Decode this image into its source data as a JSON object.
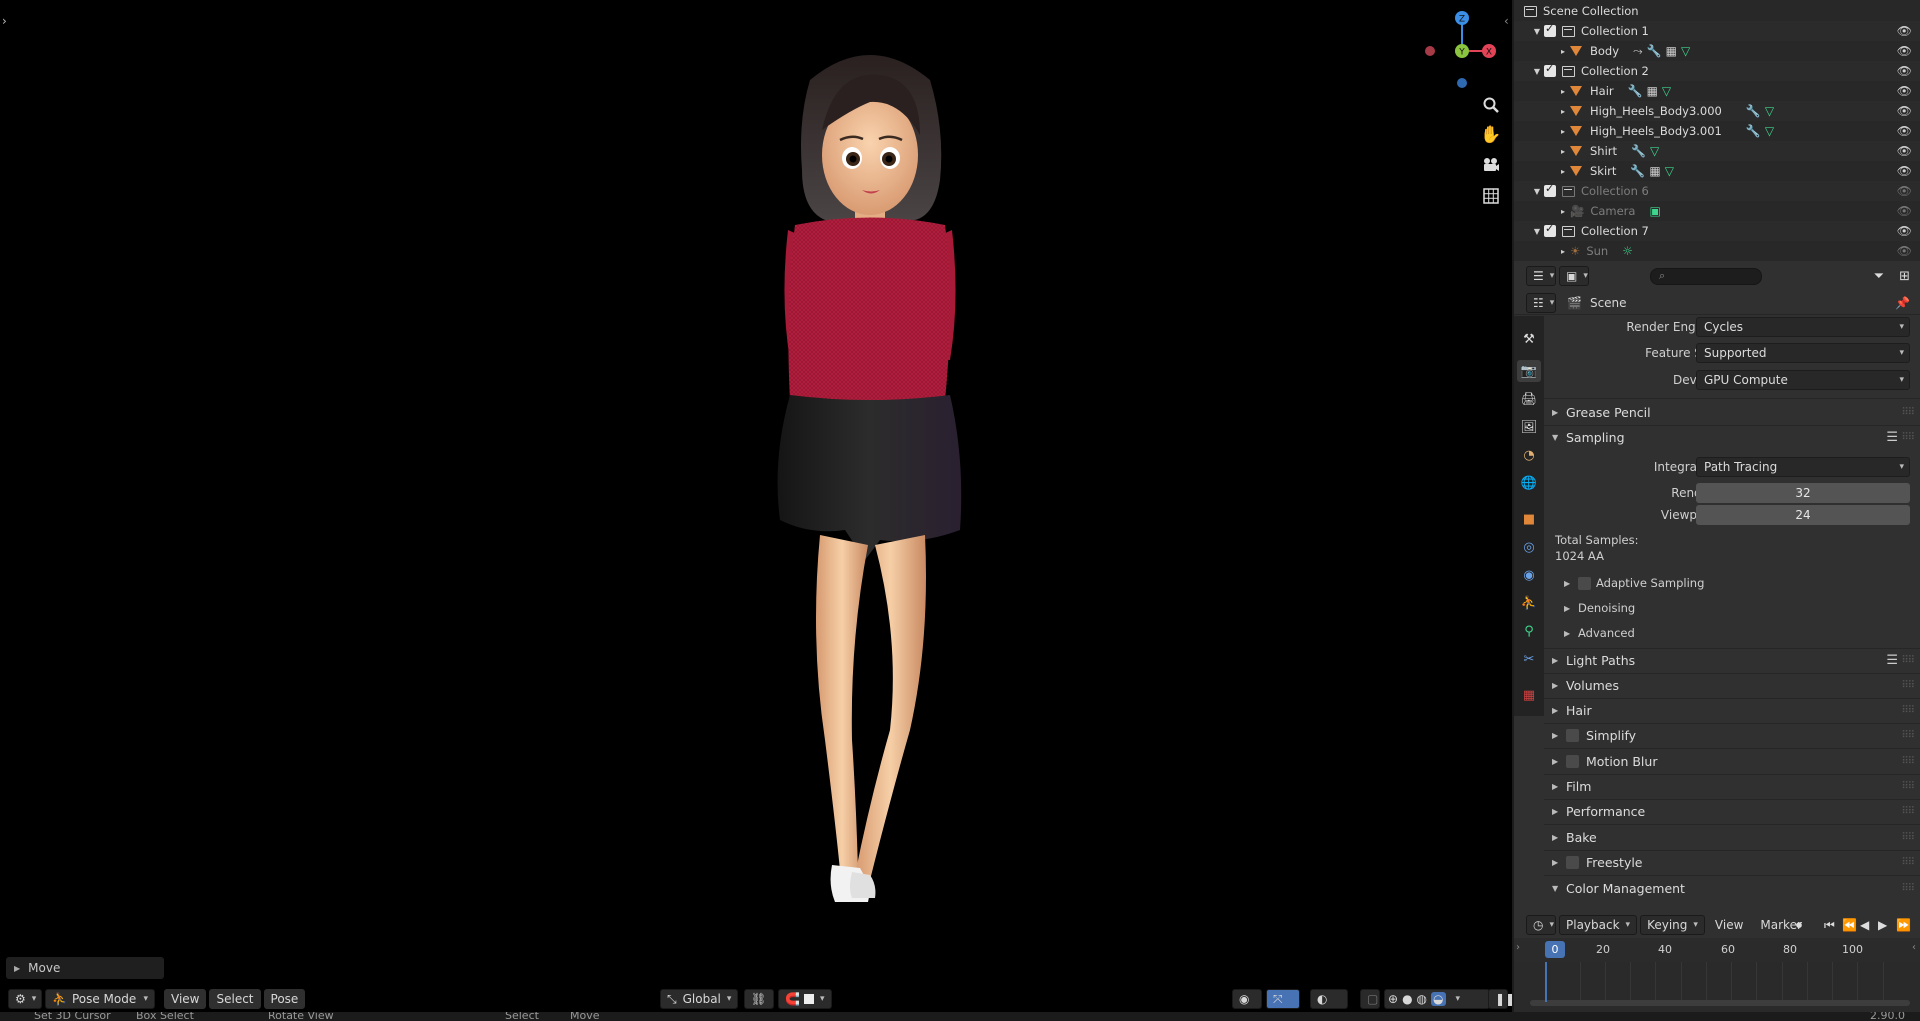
{
  "viewport": {
    "redo_panel": {
      "label": "Move"
    },
    "header": {
      "editor_type_icon": "pose-editor-icon",
      "mode": "Pose Mode",
      "menus": [
        "View",
        "Select",
        "Pose"
      ],
      "orientation": "Global"
    },
    "gizmo": {
      "z": "Z",
      "y": "Y",
      "x": "X"
    }
  },
  "statusbar": {
    "items": [
      "Set 3D Cursor",
      "Box Select",
      "Rotate View",
      "Select",
      "Move"
    ],
    "version": "2.90.0"
  },
  "outliner": {
    "root": "Scene Collection",
    "rows": [
      {
        "name": "Collection 1",
        "type": "collection",
        "dim": false
      },
      {
        "name": "Body",
        "type": "mesh",
        "dim": false
      },
      {
        "name": "Collection 2",
        "type": "collection",
        "dim": false
      },
      {
        "name": "Hair",
        "type": "mesh",
        "dim": false
      },
      {
        "name": "High_Heels_Body3.000",
        "type": "mesh",
        "dim": false
      },
      {
        "name": "High_Heels_Body3.001",
        "type": "mesh",
        "dim": false
      },
      {
        "name": "Shirt",
        "type": "mesh",
        "dim": false
      },
      {
        "name": "Skirt",
        "type": "mesh",
        "dim": false
      },
      {
        "name": "Collection 6",
        "type": "collection",
        "dim": true
      },
      {
        "name": "Camera",
        "type": "camera",
        "dim": true
      },
      {
        "name": "Collection 7",
        "type": "collection",
        "dim": false
      },
      {
        "name": "Sun",
        "type": "light",
        "dim": true
      }
    ],
    "search_placeholder": ""
  },
  "properties": {
    "context": "Scene",
    "render_engine": {
      "label": "Render Engine",
      "value": "Cycles"
    },
    "feature_set": {
      "label": "Feature Set",
      "value": "Supported"
    },
    "device": {
      "label": "Device",
      "value": "GPU Compute"
    },
    "panels": {
      "grease_pencil": "Grease Pencil",
      "sampling": "Sampling",
      "light_paths": "Light Paths",
      "volumes": "Volumes",
      "hair": "Hair",
      "simplify": "Simplify",
      "motion_blur": "Motion Blur",
      "film": "Film",
      "performance": "Performance",
      "bake": "Bake",
      "freestyle": "Freestyle",
      "color_management": "Color Management"
    },
    "sampling": {
      "integrator_label": "Integrator",
      "integrator_value": "Path Tracing",
      "render_label": "Render",
      "render_value": "32",
      "viewport_label": "Viewport",
      "viewport_value": "24",
      "total_label": "Total Samples:",
      "total_value": "1024 AA",
      "adaptive": "Adaptive Sampling",
      "denoising": "Denoising",
      "advanced": "Advanced"
    }
  },
  "timeline": {
    "menus": [
      "Playback",
      "Keying",
      "View",
      "Marker"
    ],
    "current_frame": "0",
    "ticks": [
      "20",
      "40",
      "60",
      "80",
      "100"
    ]
  },
  "colors": {
    "accent": "#4772b3",
    "x_axis": "#e34356",
    "y_axis": "#8bc43f",
    "z_axis": "#3b8ee6",
    "shirt": "#b41f3e",
    "skirt": "#1e1e1e"
  }
}
